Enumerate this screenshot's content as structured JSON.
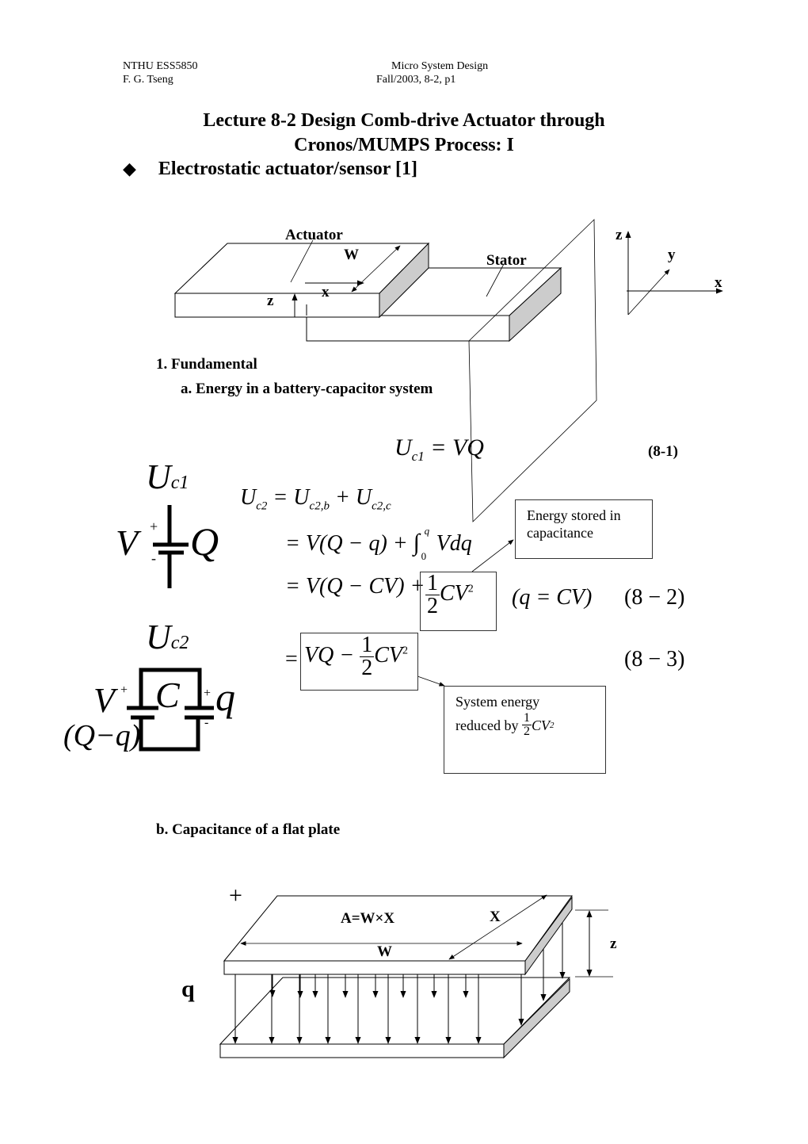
{
  "header": {
    "course": "NTHU    ESS5850",
    "author": "F. G. Tseng",
    "subject": "Micro System Design",
    "term": "Fall/2003, 8-2, p1"
  },
  "title": {
    "line1": "Lecture 8-2 Design Comb-drive Actuator through",
    "line2": "Cronos/MUMPS Process: I"
  },
  "bullet": {
    "icon": "diamond-bullet-icon",
    "glyph": "◆",
    "text": "Electrostatic actuator/sensor [1]"
  },
  "figure1": {
    "actuator_label": "Actuator",
    "stator_label": "Stator",
    "w_label": "W",
    "x_label": "x",
    "z_label": "z",
    "axes": {
      "z": "z",
      "y": "y",
      "x": "x"
    }
  },
  "section1": {
    "heading": "1.  Fundamental",
    "sub_a": "a. Energy in a battery-capacitor system",
    "sub_b": "b. Capacitance of a flat plate"
  },
  "equations": {
    "eq1": {
      "lhs": "U",
      "lhs_sub": "c1",
      "rhs": "= VQ",
      "number": "(8-1)"
    },
    "line_a": {
      "lhs": "U",
      "lhs_sub": "c2",
      "t1": "= U",
      "t1_sub": "c2,b",
      "t2": "+ U",
      "t2_sub": "c2,c"
    },
    "line_b": {
      "text": "= V(Q − q) +",
      "integral": "∫",
      "upper": "q",
      "lower": "0",
      "integrand": "Vdq"
    },
    "line_c": {
      "text": "= V(Q − CV) +",
      "frac_num": "1",
      "frac_den": "2",
      "term": "CV",
      "exp": "2",
      "cond": "(q = CV)",
      "number": "(8 − 2)"
    },
    "line_d": {
      "eq": "=",
      "text": "VQ −",
      "frac_num": "1",
      "frac_den": "2",
      "term": "CV",
      "exp": "2",
      "number": "(8 − 3)"
    }
  },
  "circuit1": {
    "title": "U",
    "title_sub": "c1",
    "v": "V",
    "q": "Q",
    "plus": "+",
    "minus": "-"
  },
  "circuit2": {
    "title": "U",
    "title_sub": "c2",
    "v": "V",
    "c": "C",
    "q": "q",
    "qq": "(Q−q)",
    "plus": "+",
    "minus": "-"
  },
  "callouts": {
    "energy_stored": "Energy stored in capacitance",
    "system_energy_line1": "System energy",
    "system_energy_line2": "reduced by",
    "frac_num": "1",
    "frac_den": "2",
    "term": "CV",
    "exp": "2"
  },
  "figure2": {
    "plus": "+",
    "q": "q",
    "area": "A=W×X",
    "x": "X",
    "w": "W",
    "z": "z"
  }
}
